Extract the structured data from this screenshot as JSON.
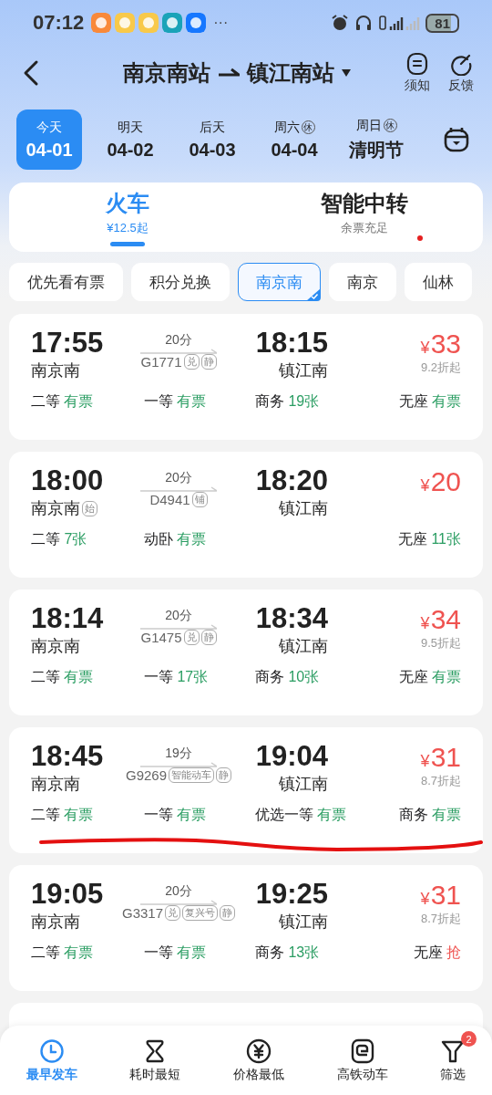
{
  "status_bar": {
    "time": "07:12",
    "more": "···",
    "battery": "81"
  },
  "header": {
    "from": "南京南站",
    "to": "镇江南站",
    "actions": [
      {
        "kind": "notice",
        "label": "须知"
      },
      {
        "kind": "feedback",
        "label": "反馈"
      }
    ]
  },
  "dates": [
    {
      "label": "今天",
      "date": "04-01",
      "selected": true
    },
    {
      "label": "明天",
      "date": "04-02",
      "selected": false
    },
    {
      "label": "后天",
      "date": "04-03",
      "selected": false
    },
    {
      "label": "周六",
      "badge": "休",
      "date": "04-04",
      "selected": false
    },
    {
      "label": "周日",
      "badge": "休",
      "date": "清明节",
      "selected": false
    }
  ],
  "mode_tabs": [
    {
      "title": "火车",
      "subtitle": "¥12.5起",
      "selected": true,
      "alert_dot": false
    },
    {
      "title": "智能中转",
      "subtitle": "余票充足",
      "selected": false,
      "alert_dot": true
    }
  ],
  "filters": [
    {
      "label": "优先看有票",
      "selected": false
    },
    {
      "label": "积分兑换",
      "selected": false
    },
    {
      "label": "南京南",
      "selected": true
    },
    {
      "label": "南京",
      "selected": false
    },
    {
      "label": "仙林",
      "selected": false
    }
  ],
  "trains": [
    {
      "depart": "17:55",
      "from": "南京南",
      "duration": "20分",
      "number": "G1771",
      "tags": [
        "兑",
        "静"
      ],
      "arrive": "18:15",
      "to": "镇江南",
      "currency": "¥",
      "price": "33",
      "discount": "9.2折起",
      "scribbled": false,
      "seats": [
        {
          "class": "二等",
          "status": "有票",
          "color": "#2a9d62"
        },
        {
          "class": "一等",
          "status": "有票",
          "color": "#2a9d62"
        },
        {
          "class": "商务",
          "status": "19张",
          "color": "#2a9d62"
        },
        {
          "class": "无座",
          "status": "有票",
          "color": "#2a9d62"
        }
      ]
    },
    {
      "depart": "18:00",
      "from": "南京南",
      "from_tag": "始",
      "duration": "20分",
      "number": "D4941",
      "tags": [
        "铺"
      ],
      "arrive": "18:20",
      "to": "镇江南",
      "currency": "¥",
      "price": "20",
      "scribbled": false,
      "seats": [
        {
          "class": "二等",
          "status": "7张",
          "color": "#2a9d62"
        },
        {
          "class": "动卧",
          "status": "有票",
          "color": "#2a9d62"
        },
        {
          "class": "无座",
          "status": "11张",
          "color": "#2a9d62"
        }
      ]
    },
    {
      "depart": "18:14",
      "from": "南京南",
      "duration": "20分",
      "number": "G1475",
      "tags": [
        "兑",
        "静"
      ],
      "arrive": "18:34",
      "to": "镇江南",
      "currency": "¥",
      "price": "34",
      "discount": "9.5折起",
      "scribbled": false,
      "seats": [
        {
          "class": "二等",
          "status": "有票",
          "color": "#2a9d62"
        },
        {
          "class": "一等",
          "status": "17张",
          "color": "#2a9d62"
        },
        {
          "class": "商务",
          "status": "10张",
          "color": "#2a9d62"
        },
        {
          "class": "无座",
          "status": "有票",
          "color": "#2a9d62"
        }
      ]
    },
    {
      "depart": "18:45",
      "from": "南京南",
      "duration": "19分",
      "number": "G9269",
      "tags": [
        "智能动车",
        "静"
      ],
      "arrive": "19:04",
      "to": "镇江南",
      "currency": "¥",
      "price": "31",
      "discount": "8.7折起",
      "scribbled": true,
      "seats": [
        {
          "class": "二等",
          "status": "有票",
          "color": "#2a9d62"
        },
        {
          "class": "一等",
          "status": "有票",
          "color": "#2a9d62"
        },
        {
          "class": "优选一等",
          "status": "有票",
          "color": "#2a9d62"
        },
        {
          "class": "商务",
          "status": "有票",
          "color": "#2a9d62"
        }
      ]
    },
    {
      "depart": "19:05",
      "from": "南京南",
      "duration": "20分",
      "number": "G3317",
      "tags": [
        "兑",
        "复兴号",
        "静"
      ],
      "arrive": "19:25",
      "to": "镇江南",
      "currency": "¥",
      "price": "31",
      "discount": "8.7折起",
      "scribbled": false,
      "seats": [
        {
          "class": "二等",
          "status": "有票",
          "color": "#2a9d62"
        },
        {
          "class": "一等",
          "status": "有票",
          "color": "#2a9d62"
        },
        {
          "class": "商务",
          "status": "13张",
          "color": "#2a9d62"
        },
        {
          "class": "无座",
          "status": "抢",
          "color": "#ef5350"
        }
      ]
    }
  ],
  "bottom_nav": [
    {
      "kind": "clock",
      "label": "最早发车",
      "selected": true
    },
    {
      "kind": "hourglass",
      "label": "耗时最短",
      "selected": false
    },
    {
      "kind": "yuan",
      "label": "价格最低",
      "selected": false
    },
    {
      "kind": "rail",
      "label": "高铁动车",
      "selected": false
    },
    {
      "kind": "filter",
      "label": "筛选",
      "badge": "2",
      "selected": false
    }
  ]
}
